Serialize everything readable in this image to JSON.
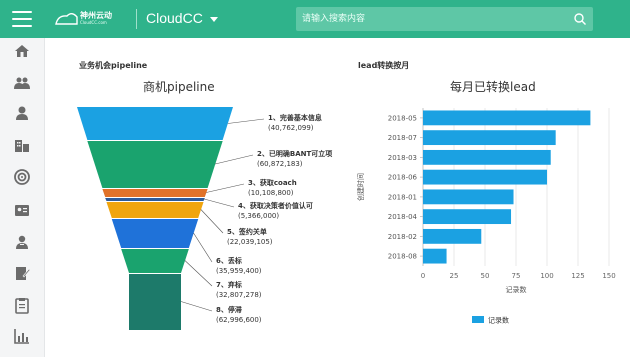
{
  "header": {
    "logo_text": "神州云动",
    "logo_sub": "CloudCC.com",
    "app_name": "CloudCC",
    "search_placeholder": "请输入搜索内容"
  },
  "colors": {
    "brand": "#2fb38b",
    "bar": "#1ba1e2"
  },
  "sidebar": {
    "items": [
      {
        "icon": "home-icon"
      },
      {
        "icon": "group-icon"
      },
      {
        "icon": "person-icon"
      },
      {
        "icon": "building-icon"
      },
      {
        "icon": "target-icon"
      },
      {
        "icon": "idcard-icon"
      },
      {
        "icon": "contact-icon"
      },
      {
        "icon": "edit-doc-icon"
      },
      {
        "icon": "clipboard-icon"
      },
      {
        "icon": "report-chart-icon"
      }
    ]
  },
  "left_panel": {
    "label": "业务机会pipeline",
    "chart_title": "商机pipeline"
  },
  "right_panel": {
    "label": "lead转换按月",
    "chart_title": "每月已转换lead"
  },
  "chart_data": [
    {
      "type": "funnel",
      "title": "商机pipeline",
      "stages": [
        {
          "label": "1、完善基本信息",
          "value": "(40,762,099)",
          "color": "#1ba1e2"
        },
        {
          "label": "2、已明确BANT可立项",
          "value": "(60,872,183)",
          "color": "#1aa36e"
        },
        {
          "label": "3、获取coach",
          "value": "(10,108,800)",
          "color": "#e0722a"
        },
        {
          "label": "4、获取决策者价值认可",
          "value": "(5,366,000)",
          "color": "#2d5b9a"
        },
        {
          "label": "5、签约关单",
          "value": "(22,039,105)",
          "color": "#f0a50f"
        },
        {
          "label": "6、丢标",
          "value": "(35,959,400)",
          "color": "#1f72d9"
        },
        {
          "label": "7、弃标",
          "value": "(32,807,278)",
          "color": "#1aa36e"
        },
        {
          "label": "8、停滞",
          "value": "(62,996,600)",
          "color": "#1d7a6a"
        }
      ]
    },
    {
      "type": "bar",
      "orientation": "horizontal",
      "title": "每月已转换lead",
      "categories": [
        "2018-05",
        "2018-07",
        "2018-03",
        "2018-06",
        "2018-01",
        "2018-04",
        "2018-02",
        "2018-08"
      ],
      "values": [
        135,
        107,
        103,
        100,
        73,
        71,
        47,
        19
      ],
      "xlabel": "记录数",
      "ylabel": "创建时间",
      "xlim": [
        0,
        150
      ],
      "xticks": [
        "0",
        "25",
        "50",
        "75",
        "100",
        "125",
        "150"
      ],
      "legend": "记录数",
      "legend_position": "bottom"
    }
  ]
}
